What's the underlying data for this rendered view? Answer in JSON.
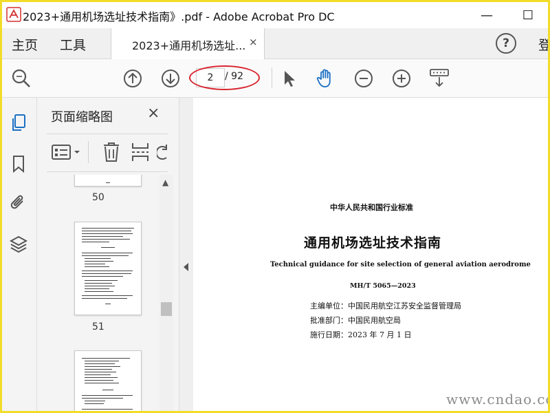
{
  "window": {
    "title": "2023+通用机场选址技术指南》.pdf - Adobe Acrobat Pro DC",
    "minimize_label": "—",
    "maximize_label": "☐"
  },
  "tabs": {
    "home": "主页",
    "tools": "工具",
    "document": "2023+通用机场选址...",
    "close": "×",
    "help": "?",
    "signin": "登"
  },
  "toolbar": {
    "current_page": "2",
    "total_pages": "/ 92"
  },
  "panel": {
    "title": "页面缩略图",
    "close": "×",
    "thumbnails": [
      {
        "label": "50"
      },
      {
        "label": "51"
      }
    ]
  },
  "document": {
    "standard_type": "中华人民共和国行业标准",
    "title_cn": "通用机场选址技术指南",
    "title_en": "Technical guidance for site selection of general aviation aerodrome",
    "code": "MH/T 5065—2023",
    "editor": "主编单位：中国民用航空江苏安全监督管理局",
    "approver": "批准部门：中国民用航空局",
    "effective": "施行日期：2023 年 7 月 1 日"
  },
  "watermark": "www.cndao.com",
  "colors": {
    "frame": "#f2dc2a",
    "accent_blue": "#1a6fc4",
    "annotation_red": "#d9232e"
  }
}
